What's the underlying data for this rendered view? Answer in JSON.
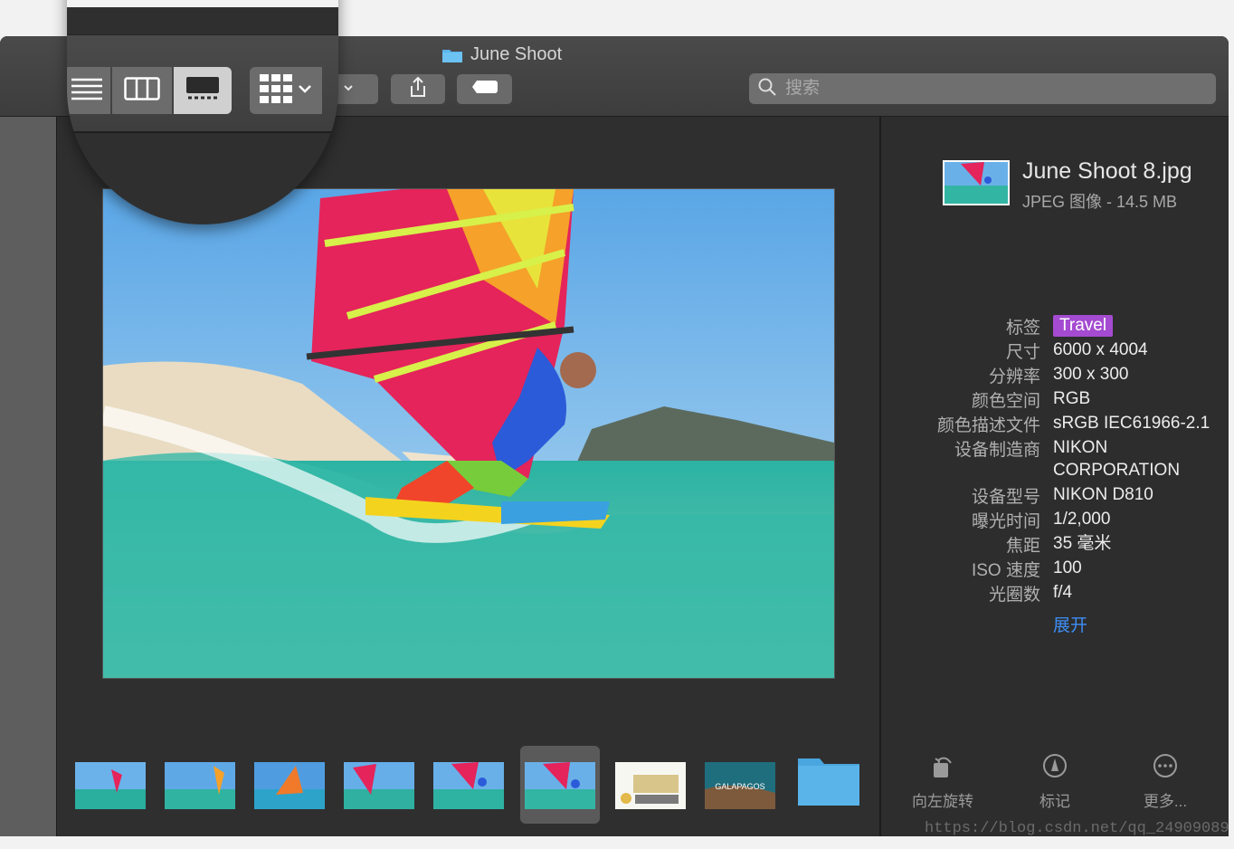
{
  "window": {
    "title": "June Shoot"
  },
  "search": {
    "placeholder": "搜索"
  },
  "file": {
    "name": "June Shoot 8.jpg",
    "type_size": "JPEG 图像 - 14.5 MB"
  },
  "metadata": [
    {
      "key": "标签",
      "value": "Travel"
    },
    {
      "key": "尺寸",
      "value": "6000 x 4004"
    },
    {
      "key": "分辨率",
      "value": "300 x 300"
    },
    {
      "key": "颜色空间",
      "value": "RGB"
    },
    {
      "key": "颜色描述文件",
      "value": "sRGB IEC61966-2.1"
    },
    {
      "key": "设备制造商",
      "value": "NIKON"
    },
    {
      "key": "",
      "value": "CORPORATION"
    },
    {
      "key": "设备型号",
      "value": "NIKON D810"
    },
    {
      "key": "曝光时间",
      "value": "1/2,000"
    },
    {
      "key": "焦距",
      "value": "35 毫米"
    },
    {
      "key": "ISO 速度",
      "value": "100"
    },
    {
      "key": "光圈数",
      "value": "f/4"
    }
  ],
  "expand_label": "展开",
  "actions": [
    {
      "label": "向左旋转",
      "icon": "rotate-left-icon"
    },
    {
      "label": "标记",
      "icon": "markup-icon"
    },
    {
      "label": "更多...",
      "icon": "more-icon"
    }
  ],
  "thumbnails": [
    {
      "label": ""
    },
    {
      "label": ""
    },
    {
      "label": ""
    },
    {
      "label": ""
    },
    {
      "label": ""
    },
    {
      "label": ""
    },
    {
      "label": ""
    },
    {
      "label": "GALAPAGOS"
    },
    {
      "label": ""
    }
  ],
  "watermark": "https://blog.csdn.net/qq_24909089",
  "colors": {
    "tag": "#a44bd1",
    "link": "#3d8ef5",
    "folder": "#5ab4ea"
  }
}
